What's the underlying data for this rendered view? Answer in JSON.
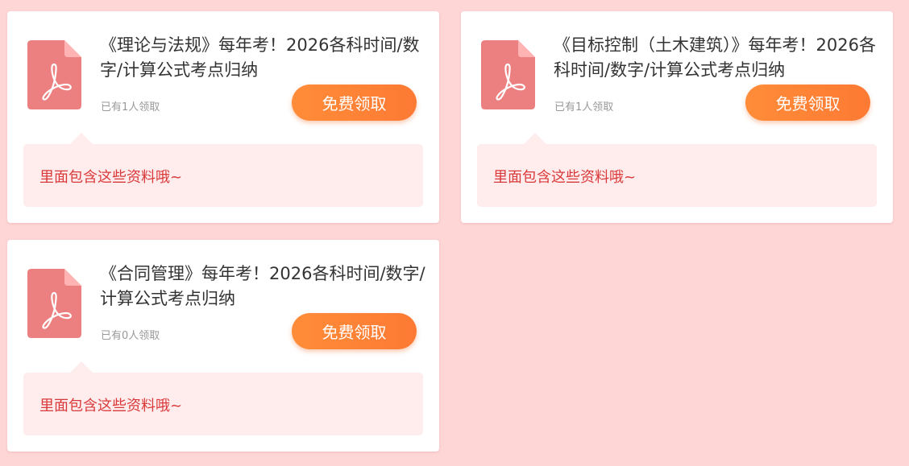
{
  "colors": {
    "background": "#ffd6d6",
    "accent": "#ff8533",
    "icon": "#ec7f7f",
    "bubble": "#ffecec",
    "bubble_text": "#d9393a"
  },
  "cards": [
    {
      "icon": "pdf-file-icon",
      "title": "《理论与法规》每年考！2026各科时间/数字/计算公式考点归纳",
      "count": "已有1人领取",
      "button": "免费领取",
      "bubble": "里面包含这些资料哦~"
    },
    {
      "icon": "pdf-file-icon",
      "title": "《目标控制（土木建筑）》每年考！2026各科时间/数字/计算公式考点归纳",
      "count": "已有1人领取",
      "button": "免费领取",
      "bubble": "里面包含这些资料哦~"
    },
    {
      "icon": "pdf-file-icon",
      "title": "《合同管理》每年考！2026各科时间/数字/计算公式考点归纳",
      "count": "已有0人领取",
      "button": "免费领取",
      "bubble": "里面包含这些资料哦~"
    }
  ]
}
